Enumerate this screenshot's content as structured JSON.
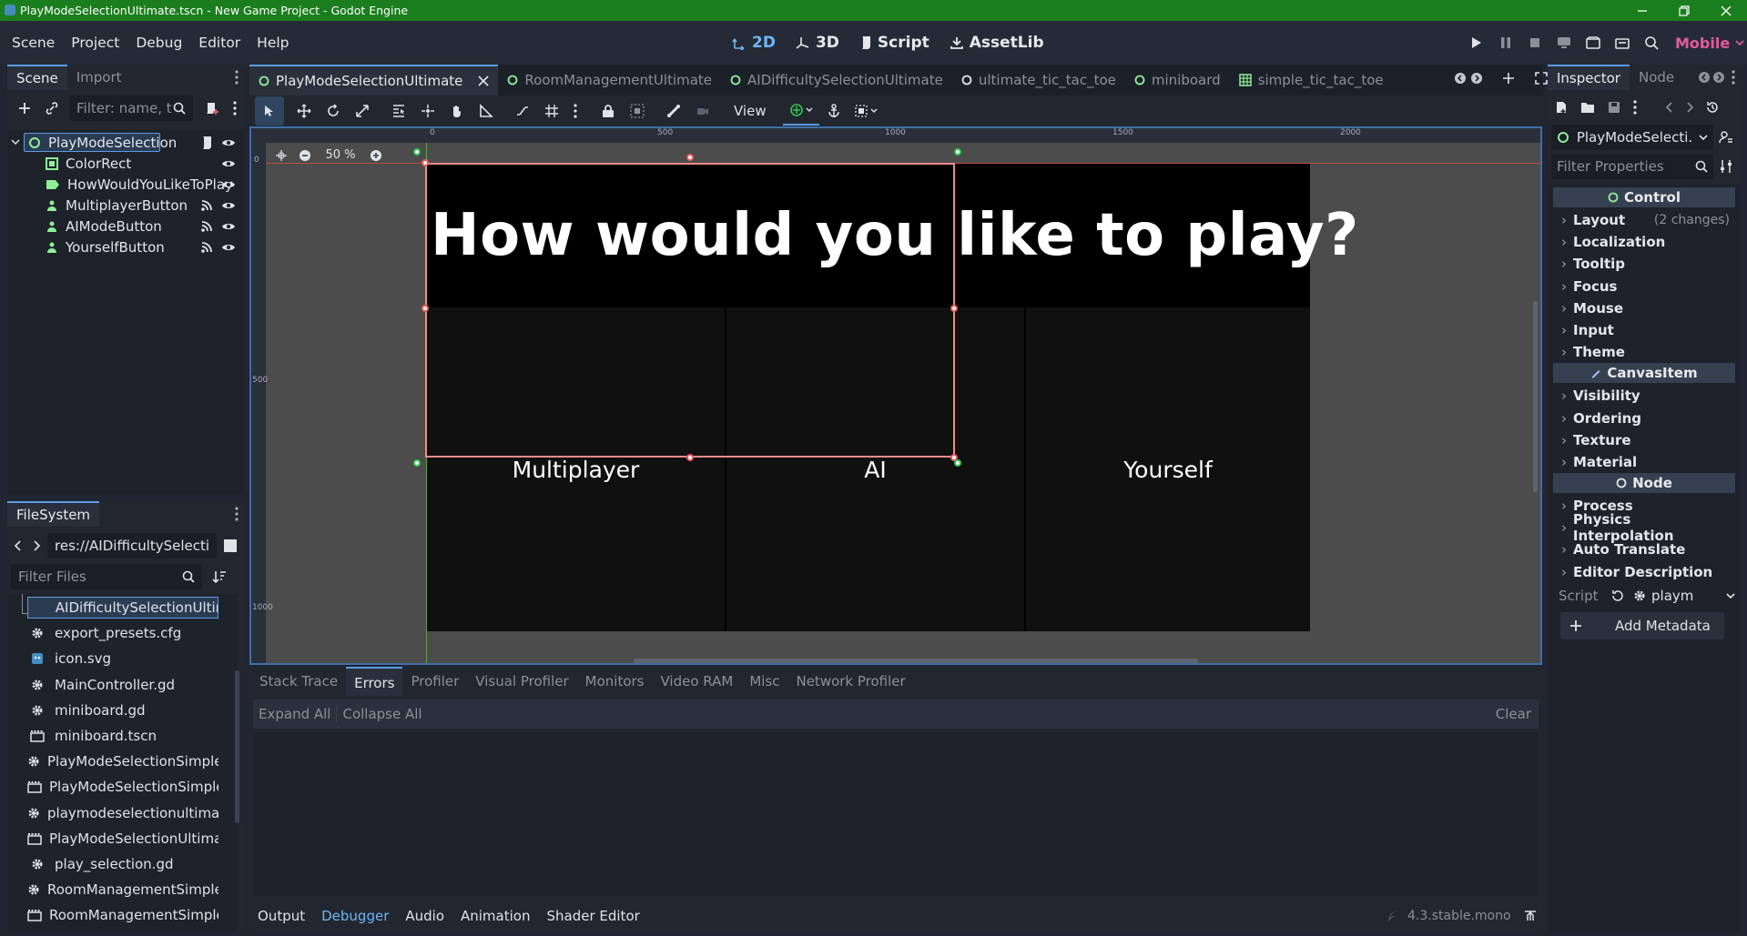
{
  "titlebar": {
    "title": "PlayModeSelectionUltimate.tscn - New Game Project - Godot Engine"
  },
  "menus": [
    "Scene",
    "Project",
    "Debug",
    "Editor",
    "Help"
  ],
  "workspaces": [
    {
      "label": "2D",
      "icon": "2d-icon",
      "active": true
    },
    {
      "label": "3D",
      "icon": "3d-icon",
      "active": false
    },
    {
      "label": "Script",
      "icon": "script-icon",
      "active": false
    },
    {
      "label": "AssetLib",
      "icon": "assetlib-icon",
      "active": false
    }
  ],
  "renderer": "Mobile",
  "scene_dock": {
    "tabs": [
      "Scene",
      "Import"
    ],
    "filter_placeholder": "Filter: name, t:",
    "nodes": [
      {
        "name": "PlayModeSelection",
        "icon": "control-icon",
        "depth": 0,
        "selected": true,
        "has_script": true,
        "visible": true
      },
      {
        "name": "ColorRect",
        "icon": "colorrect-icon",
        "depth": 1,
        "visible": true
      },
      {
        "name": "HowWouldYouLikeToPlay",
        "icon": "label-icon",
        "depth": 1,
        "visible": true
      },
      {
        "name": "MultiplayerButton",
        "icon": "button-icon",
        "depth": 1,
        "signals": true,
        "visible": true
      },
      {
        "name": "AIModeButton",
        "icon": "button-icon",
        "depth": 1,
        "signals": true,
        "visible": true
      },
      {
        "name": "YourselfButton",
        "icon": "button-icon",
        "depth": 1,
        "signals": true,
        "visible": true
      }
    ]
  },
  "filesystem": {
    "tab": "FileSystem",
    "path": "res://AIDifficultySelection",
    "filter_placeholder": "Filter Files",
    "files": [
      {
        "name": "AIDifficultySelectionUltim...",
        "icon": "scene-icon",
        "selected": true
      },
      {
        "name": "export_presets.cfg",
        "icon": "gear-file-icon"
      },
      {
        "name": "icon.svg",
        "icon": "image-icon"
      },
      {
        "name": "MainController.gd",
        "icon": "gear-file-icon"
      },
      {
        "name": "miniboard.gd",
        "icon": "gear-file-icon"
      },
      {
        "name": "miniboard.tscn",
        "icon": "scene-icon"
      },
      {
        "name": "PlayModeSelectionSimple...",
        "icon": "gear-file-icon"
      },
      {
        "name": "PlayModeSelectionSimple...",
        "icon": "scene-icon"
      },
      {
        "name": "playmodeselectionultimat...",
        "icon": "gear-file-icon"
      },
      {
        "name": "PlayModeSelectionUltima...",
        "icon": "scene-icon"
      },
      {
        "name": "play_selection.gd",
        "icon": "gear-file-icon"
      },
      {
        "name": "RoomManagementSimple...",
        "icon": "gear-file-icon"
      },
      {
        "name": "RoomManagementSimple...",
        "icon": "scene-icon"
      }
    ]
  },
  "editor_tabs": [
    {
      "label": "PlayModeSelectionUltimate",
      "active": true,
      "icon": "control-icon"
    },
    {
      "label": "RoomManagementUltimate",
      "active": false,
      "icon": "control-icon"
    },
    {
      "label": "AIDifficultySelectionUltimate",
      "active": false,
      "icon": "control-icon"
    },
    {
      "label": "ultimate_tic_tac_toe",
      "active": false,
      "icon": "node-icon"
    },
    {
      "label": "miniboard",
      "active": false,
      "icon": "control-icon"
    },
    {
      "label": "simple_tic_tac_toe",
      "active": false,
      "icon": "grid-icon"
    }
  ],
  "toolbar": {
    "view_label": "View"
  },
  "viewport": {
    "zoom": "50 %",
    "ruler_ticks": [
      "0",
      "500",
      "1000",
      "1500",
      "2000"
    ],
    "vruler_ticks": [
      "0",
      "500",
      "1000"
    ],
    "heading": "How would you like to play?",
    "buttons": [
      "Multiplayer",
      "AI",
      "Yourself"
    ]
  },
  "bottom_panel": {
    "debugger_tabs": [
      "Stack Trace",
      "Errors",
      "Profiler",
      "Visual Profiler",
      "Monitors",
      "Video RAM",
      "Misc",
      "Network Profiler"
    ],
    "active_debugger_tab": "Errors",
    "expand_all": "Expand All",
    "collapse_all": "Collapse All",
    "clear": "Clear",
    "bottom_tabs": [
      "Output",
      "Debugger",
      "Audio",
      "Animation",
      "Shader Editor"
    ],
    "active_bottom_tab": "Debugger",
    "version": "4.3.stable.mono"
  },
  "inspector": {
    "tabs": [
      "Inspector",
      "Node"
    ],
    "selected_node": "PlayModeSelecti...",
    "filter_placeholder": "Filter Properties",
    "categories": [
      {
        "type": "category",
        "label": "Control",
        "icon": "control-icon"
      },
      {
        "type": "section",
        "label": "Layout",
        "note": "(2 changes)"
      },
      {
        "type": "section",
        "label": "Localization"
      },
      {
        "type": "section",
        "label": "Tooltip"
      },
      {
        "type": "section",
        "label": "Focus"
      },
      {
        "type": "section",
        "label": "Mouse"
      },
      {
        "type": "section",
        "label": "Input"
      },
      {
        "type": "section",
        "label": "Theme"
      },
      {
        "type": "category",
        "label": "CanvasItem",
        "icon": "canvasitem-icon"
      },
      {
        "type": "section",
        "label": "Visibility"
      },
      {
        "type": "section",
        "label": "Ordering"
      },
      {
        "type": "section",
        "label": "Texture"
      },
      {
        "type": "section",
        "label": "Material"
      },
      {
        "type": "category",
        "label": "Node",
        "icon": "node-icon"
      },
      {
        "type": "section",
        "label": "Process"
      },
      {
        "type": "section",
        "label": "Physics Interpolation"
      },
      {
        "type": "section",
        "label": "Auto Translate"
      },
      {
        "type": "section",
        "label": "Editor Description"
      }
    ],
    "script_label": "Script",
    "script_value": "playm",
    "add_metadata": "Add Metadata"
  },
  "colors": {
    "accent": "#5a9de1",
    "title_bar": "#1b7e1e",
    "selection_outline": "#e85c5c",
    "renderer": "#e05c9a"
  }
}
